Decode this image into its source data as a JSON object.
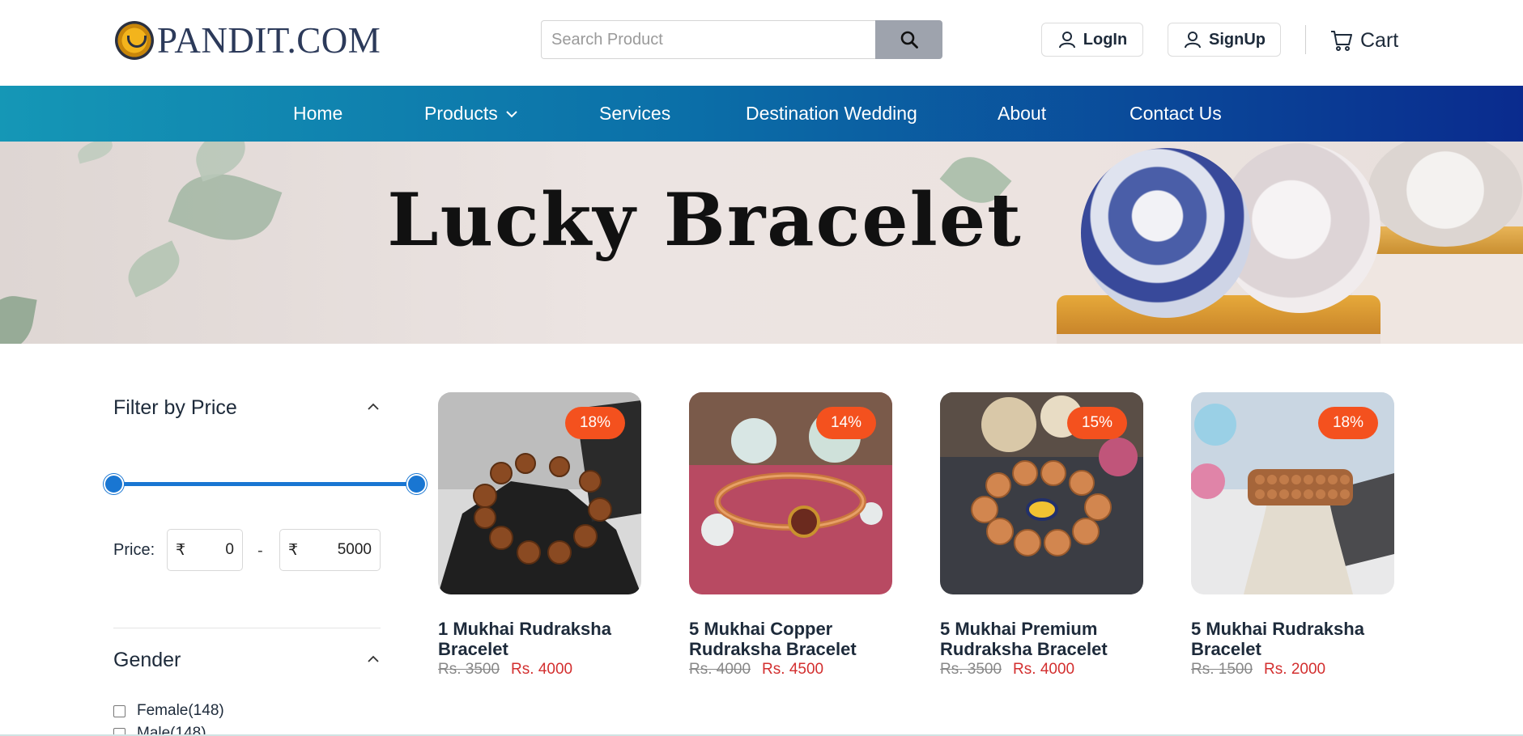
{
  "header": {
    "logo_text": "PANDIT.COM",
    "search_placeholder": "Search Product",
    "login_label": "LogIn",
    "signup_label": "SignUp",
    "cart_label": "Cart"
  },
  "nav": {
    "items": [
      {
        "label": "Home"
      },
      {
        "label": "Products"
      },
      {
        "label": "Services"
      },
      {
        "label": "Destination Wedding"
      },
      {
        "label": "About"
      },
      {
        "label": "Contact Us"
      }
    ]
  },
  "banner": {
    "title": "Lucky Bracelet"
  },
  "filters": {
    "price": {
      "title": "Filter by Price",
      "label": "Price:",
      "currency": "₹",
      "min": "0",
      "max": "5000",
      "separator": "-",
      "range_fraction_low": 0,
      "range_fraction_high": 1
    },
    "gender": {
      "title": "Gender",
      "options": [
        {
          "label": "Female(148)",
          "checked": false
        },
        {
          "label": "Male(148)",
          "checked": false
        }
      ]
    }
  },
  "products": [
    {
      "name_line1": "1 Mukhai Rudraksha",
      "name_line2": "Bracelet",
      "discount": "18%",
      "old_price": "Rs. 3500",
      "new_price": "Rs. 4000"
    },
    {
      "name_line1": "5 Mukhai Copper",
      "name_line2": "Rudraksha Bracelet",
      "discount": "14%",
      "old_price": "Rs. 4000",
      "new_price": "Rs. 4500"
    },
    {
      "name_line1": "5 Mukhai Premium",
      "name_line2": "Rudraksha Bracelet",
      "discount": "15%",
      "old_price": "Rs. 3500",
      "new_price": "Rs. 4000"
    },
    {
      "name_line1": "5 Mukhai Rudraksha",
      "name_line2": "Bracelet",
      "discount": "18%",
      "old_price": "Rs. 1500",
      "new_price": "Rs. 2000"
    }
  ],
  "colors": {
    "nav_start": "#1597b6",
    "nav_end": "#0a2b8e",
    "discount_badge": "#f4511e",
    "price_new": "#d32f2f",
    "slider": "#1976d2"
  }
}
